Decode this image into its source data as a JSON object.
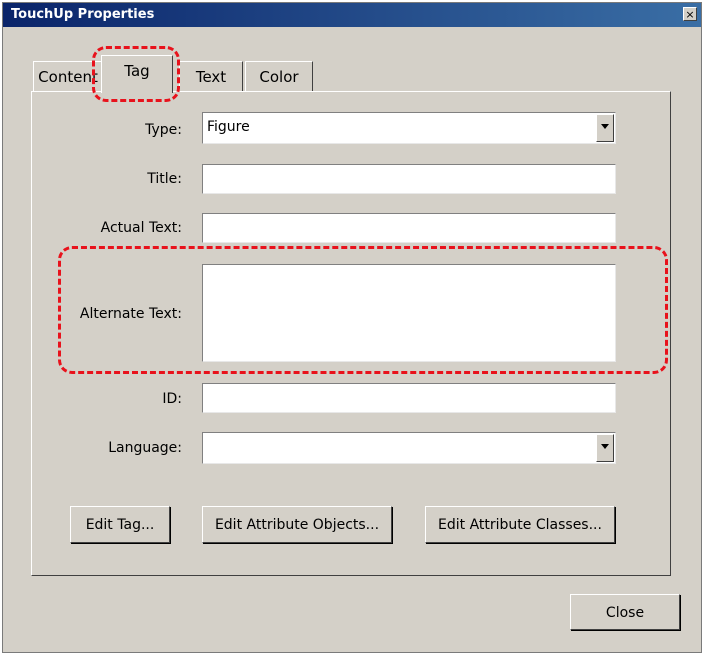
{
  "window": {
    "title": "TouchUp Properties",
    "close_symbol": "×"
  },
  "tabs": [
    {
      "label": "Content"
    },
    {
      "label": "Tag"
    },
    {
      "label": "Text"
    },
    {
      "label": "Color"
    }
  ],
  "form": {
    "type_label": "Type:",
    "type_value": "Figure",
    "title_label": "Title:",
    "title_value": "",
    "actual_text_label": "Actual Text:",
    "actual_text_value": "",
    "alternate_text_label": "Alternate Text:",
    "alternate_text_value": "",
    "id_label": "ID:",
    "id_value": "",
    "language_label": "Language:",
    "language_value": ""
  },
  "buttons": {
    "edit_tag": "Edit Tag...",
    "edit_attribute_objects": "Edit Attribute Objects...",
    "edit_attribute_classes": "Edit Attribute Classes...",
    "close": "Close"
  },
  "colors": {
    "highlight": "#e8121c",
    "titlebar": "#0a246a",
    "dialog_bg": "#d4d0c8"
  }
}
